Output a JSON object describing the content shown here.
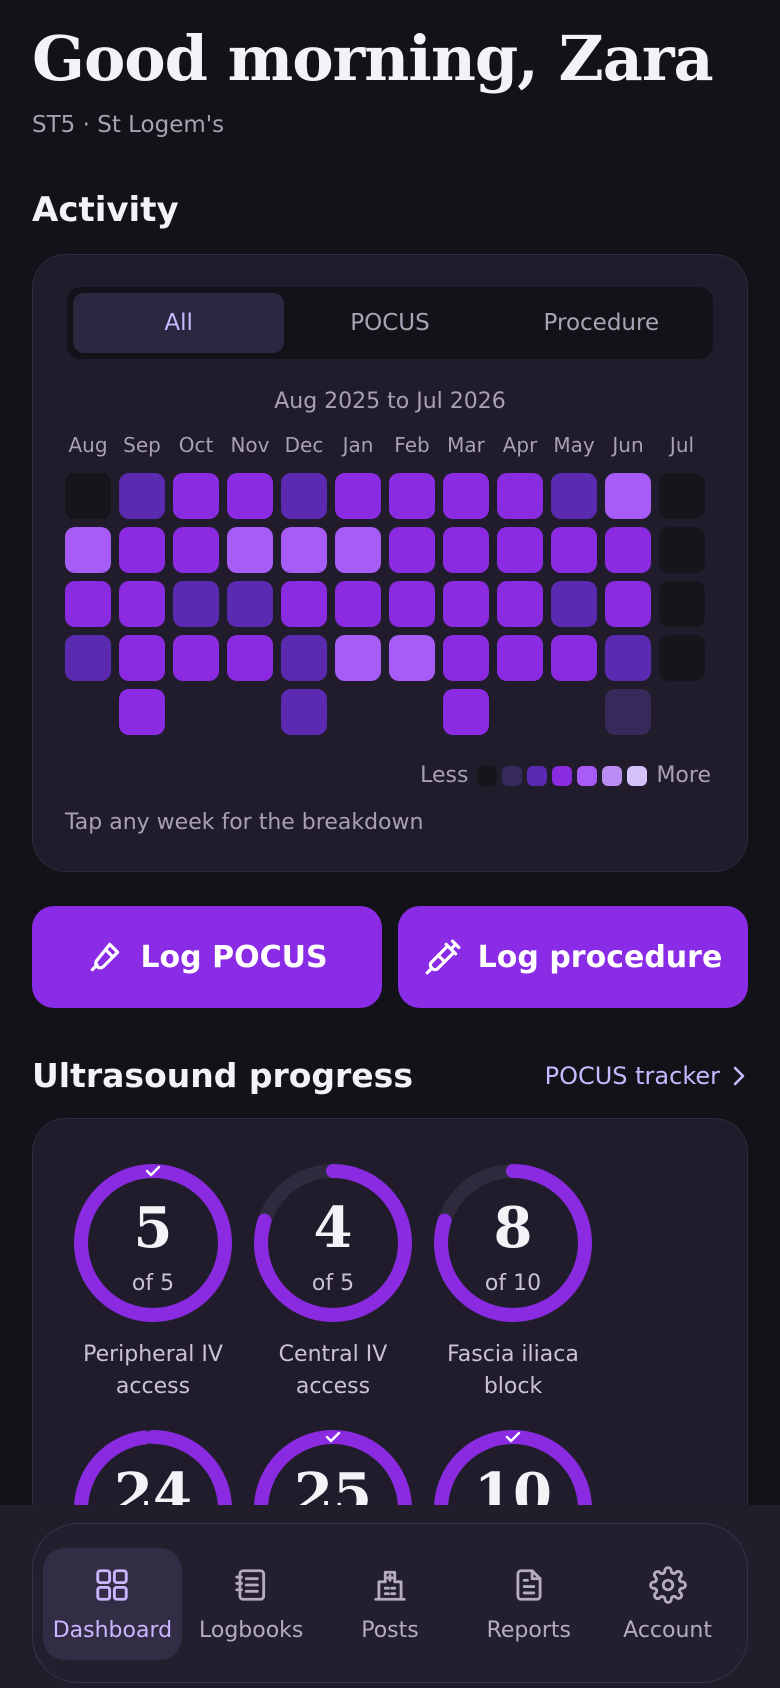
{
  "header": {
    "greeting": "Good morning, Zara",
    "subtitle": "ST5 · St Logem's"
  },
  "activity": {
    "title": "Activity",
    "tabs": [
      "All",
      "POCUS",
      "Procedure"
    ],
    "active_tab": "All",
    "range": "Aug 2025 to Jul 2026",
    "months": [
      "Aug",
      "Sep",
      "Oct",
      "Nov",
      "Dec",
      "Jan",
      "Feb",
      "Mar",
      "Apr",
      "May",
      "Jun",
      "Jul"
    ],
    "weeks_levels": [
      [
        0,
        4,
        3,
        2
      ],
      [
        2,
        3,
        3,
        3,
        3
      ],
      [
        3,
        3,
        2,
        3
      ],
      [
        3,
        4,
        2,
        3
      ],
      [
        2,
        4,
        3,
        2,
        2
      ],
      [
        3,
        4,
        3,
        4
      ],
      [
        3,
        3,
        3,
        4
      ],
      [
        3,
        3,
        3,
        3,
        3
      ],
      [
        3,
        3,
        3,
        3
      ],
      [
        2,
        3,
        2,
        3
      ],
      [
        4,
        3,
        3,
        2,
        1
      ],
      [
        0,
        0,
        0,
        0
      ]
    ],
    "level_colors": [
      "#17151c",
      "#352a5a",
      "#5a2bb0",
      "#8a2be2",
      "#a85cf7",
      "#b98cf4",
      "#d6c2fb"
    ],
    "legend_less": "Less",
    "legend_more": "More",
    "hint": "Tap any week for the breakdown"
  },
  "actions": {
    "log_pocus": "Log POCUS",
    "log_procedure": "Log procedure"
  },
  "progress": {
    "title": "Ultrasound progress",
    "link": "POCUS tracker",
    "accent": "#8a2be2",
    "track": "#2f2a3d",
    "items": [
      {
        "value": "5",
        "of": "of 5",
        "label1": "Peripheral IV",
        "label2": "access",
        "fraction": 1.0,
        "complete": true
      },
      {
        "value": "4",
        "of": "of 5",
        "label1": "Central IV",
        "label2": "access",
        "fraction": 0.8,
        "complete": false
      },
      {
        "value": "8",
        "of": "of 10",
        "label1": "Fascia iliaca",
        "label2": "block",
        "fraction": 0.8,
        "complete": false
      },
      {
        "value": "24",
        "fraction": 0.98,
        "complete": false
      },
      {
        "value": "25",
        "fraction": 1.0,
        "complete": true
      },
      {
        "value": "10",
        "fraction": 1.0,
        "complete": true
      }
    ]
  },
  "nav": {
    "items": [
      "Dashboard",
      "Logbooks",
      "Posts",
      "Reports",
      "Account"
    ],
    "active": "Dashboard"
  }
}
